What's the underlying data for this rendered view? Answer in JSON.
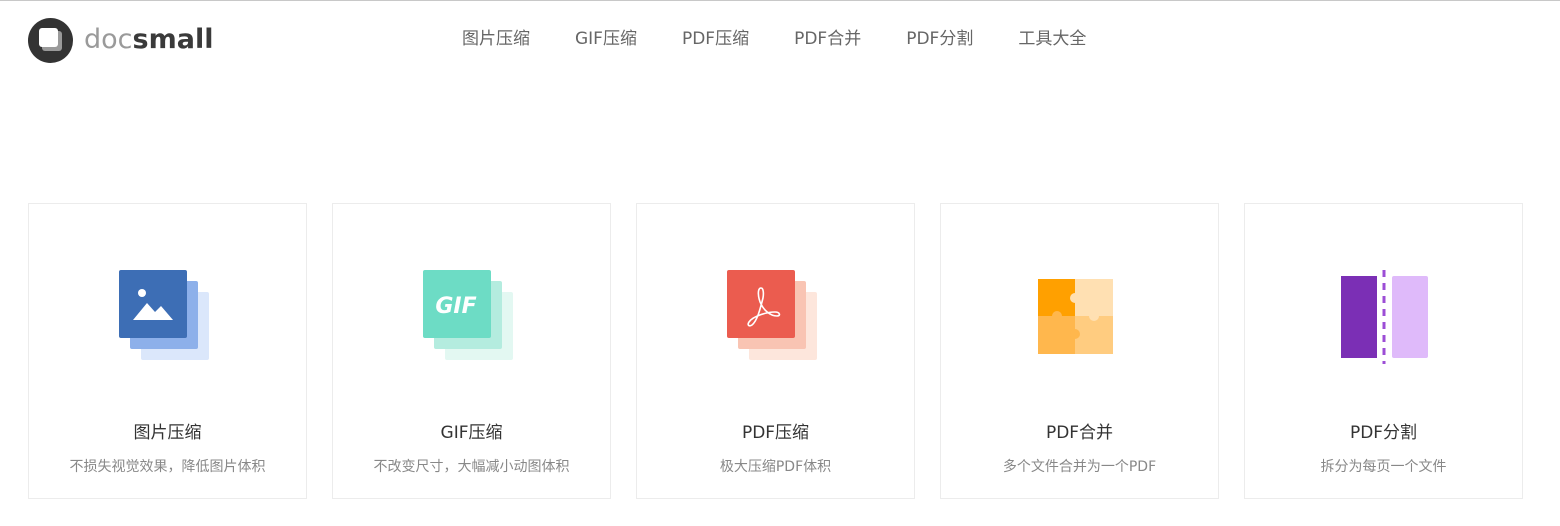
{
  "logo": {
    "text_light": "doc",
    "text_bold": "small"
  },
  "nav": [
    {
      "label": "图片压缩"
    },
    {
      "label": "GIF压缩"
    },
    {
      "label": "PDF压缩"
    },
    {
      "label": "PDF合并"
    },
    {
      "label": "PDF分割"
    },
    {
      "label": "工具大全"
    }
  ],
  "cards": [
    {
      "title": "图片压缩",
      "desc": "不损失视觉效果，降低图片体积",
      "icon": "image-compress-icon",
      "color": "#3d6eb5"
    },
    {
      "title": "GIF压缩",
      "desc": "不改变尺寸，大幅减小动图体积",
      "icon": "gif-compress-icon",
      "color": "#6ddcc5",
      "icon_text": "GIF"
    },
    {
      "title": "PDF压缩",
      "desc": "极大压缩PDF体积",
      "icon": "pdf-compress-icon",
      "color": "#eb5c4f"
    },
    {
      "title": "PDF合并",
      "desc": "多个文件合并为一个PDF",
      "icon": "puzzle-merge-icon",
      "color": "#ffa32b"
    },
    {
      "title": "PDF分割",
      "desc": "拆分为每页一个文件",
      "icon": "pdf-split-icon",
      "color": "#7b2fb5"
    }
  ],
  "colors": {
    "accent_blue": "#3d6eb5",
    "accent_teal": "#6ddcc5",
    "accent_red": "#eb5c4f",
    "accent_orange": "#ffa32b",
    "accent_purple": "#7b2fb5"
  }
}
